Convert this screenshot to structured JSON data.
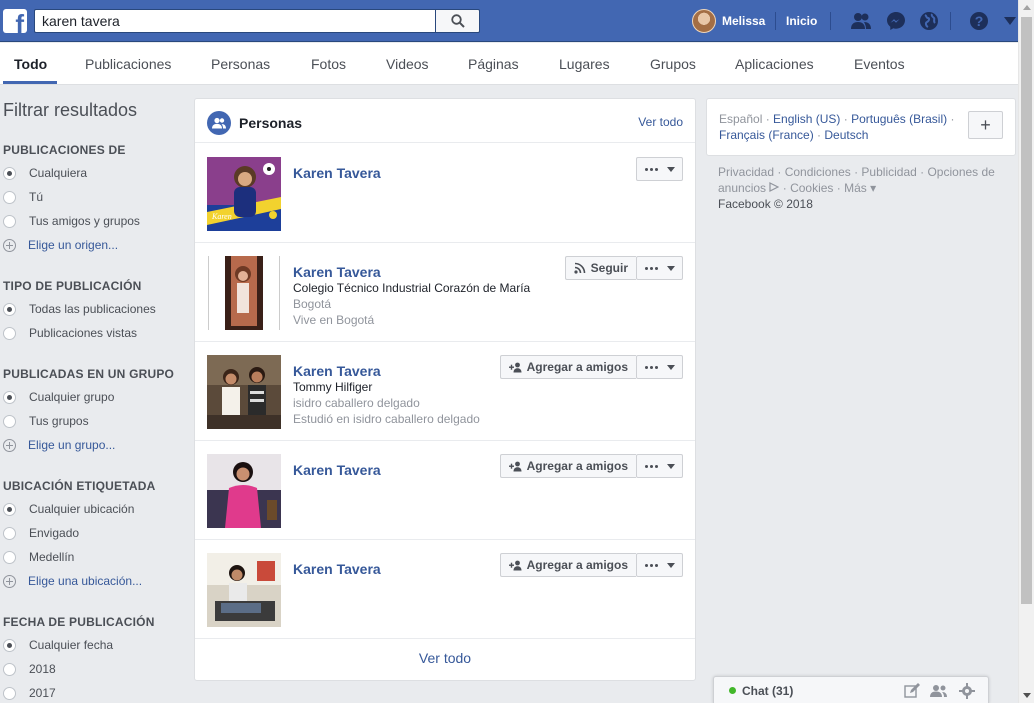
{
  "topbar": {
    "logo": "f",
    "search_value": "karen tavera",
    "search_icon": "magnifier-icon",
    "user_name": "Melissa",
    "home_label": "Inicio",
    "icons": [
      "friend-requests-icon",
      "messenger-icon",
      "notifications-globe-icon",
      "help-icon",
      "account-menu-caret-icon"
    ]
  },
  "tabs": [
    "Todo",
    "Publicaciones",
    "Personas",
    "Fotos",
    "Videos",
    "Páginas",
    "Lugares",
    "Grupos",
    "Aplicaciones",
    "Eventos"
  ],
  "sidebar": {
    "title": "Filtrar resultados",
    "groups": [
      {
        "heading": "PUBLICACIONES DE",
        "options": [
          "Cualquiera",
          "Tú",
          "Tus amigos y grupos"
        ],
        "selected": "Cualquiera",
        "link": "Elige un origen..."
      },
      {
        "heading": "TIPO DE PUBLICACIÓN",
        "options": [
          "Todas las publicaciones",
          "Publicaciones vistas"
        ],
        "selected": "Todas las publicaciones"
      },
      {
        "heading": "PUBLICADAS EN UN GRUPO",
        "options": [
          "Cualquier grupo",
          "Tus grupos"
        ],
        "selected": "Cualquier grupo",
        "link": "Elige un grupo..."
      },
      {
        "heading": "UBICACIÓN ETIQUETADA",
        "options": [
          "Cualquier ubicación",
          "Envigado",
          "Medellín"
        ],
        "selected": "Cualquier ubicación",
        "link": "Elige una ubicación..."
      },
      {
        "heading": "FECHA DE PUBLICACIÓN",
        "options": [
          "Cualquier fecha",
          "2018",
          "2017"
        ],
        "selected": "Cualquier fecha"
      }
    ]
  },
  "people_card": {
    "title": "Personas",
    "see_all_top": "Ver todo",
    "see_all_bottom": "Ver todo",
    "results": [
      {
        "name": "Karen Tavera",
        "line1": "",
        "line2": "",
        "line3": "",
        "action": ""
      },
      {
        "name": "Karen Tavera",
        "line1": "Colegio Técnico Industrial Corazón de María",
        "line2": "Bogotá",
        "line3": "Vive en Bogotá",
        "action": "Seguir"
      },
      {
        "name": "Karen Tavera",
        "line1": "Tommy Hilfiger",
        "line2": "isidro caballero delgado",
        "line3": "Estudió en isidro caballero delgado",
        "action": "Agregar a amigos"
      },
      {
        "name": "Karen Tavera",
        "line1": "",
        "line2": "",
        "line3": "",
        "action": "Agregar a amigos"
      },
      {
        "name": "Karen Tavera",
        "line1": "",
        "line2": "",
        "line3": "",
        "action": "Agregar a amigos"
      }
    ]
  },
  "languages": {
    "current": "Español",
    "others": [
      "English (US)",
      "Português (Brasil)",
      "Français (France)",
      "Deutsch"
    ],
    "add_label": "+"
  },
  "footer": {
    "links": [
      "Privacidad",
      "Condiciones",
      "Publicidad",
      "Opciones de anuncios",
      "Cookies",
      "Más"
    ],
    "copyright": "Facebook © 2018"
  },
  "chat": {
    "label": "Chat (31)",
    "status_color": "#42b72a"
  },
  "colors": {
    "brand": "#4267b2",
    "link": "#365899",
    "background": "#e9ebee"
  }
}
